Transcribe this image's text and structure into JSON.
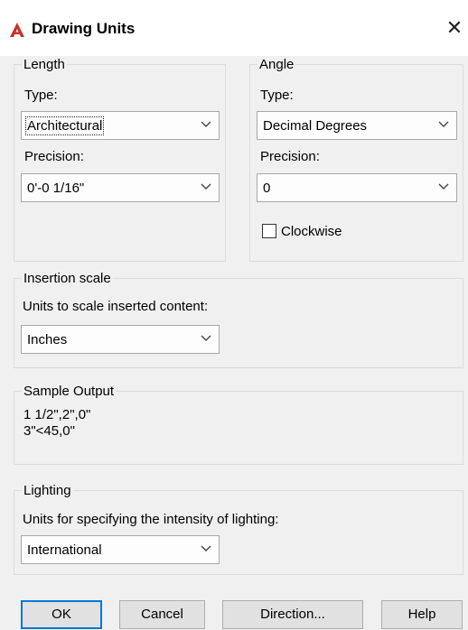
{
  "window": {
    "title": "Drawing Units",
    "close_glyph": "✕",
    "icon": "autocad-a-icon",
    "accent": "#c8322d"
  },
  "length": {
    "legend": "Length",
    "type_label": "Type:",
    "type_value": "Architectural",
    "precision_label": "Precision:",
    "precision_value": "0'-0 1/16\""
  },
  "angle": {
    "legend": "Angle",
    "type_label": "Type:",
    "type_value": "Decimal Degrees",
    "precision_label": "Precision:",
    "precision_value": "0",
    "clockwise_label": "Clockwise",
    "clockwise_checked": false
  },
  "insertion": {
    "legend": "Insertion scale",
    "label": "Units to scale inserted content:",
    "value": "Inches"
  },
  "sample": {
    "legend": "Sample Output",
    "line1": "1 1/2\",2\",0\"",
    "line2": "3\"<45,0\""
  },
  "lighting": {
    "legend": "Lighting",
    "label": "Units for specifying the intensity of lighting:",
    "value": "International"
  },
  "buttons": {
    "ok": "OK",
    "cancel": "Cancel",
    "direction": "Direction...",
    "help": "Help"
  }
}
